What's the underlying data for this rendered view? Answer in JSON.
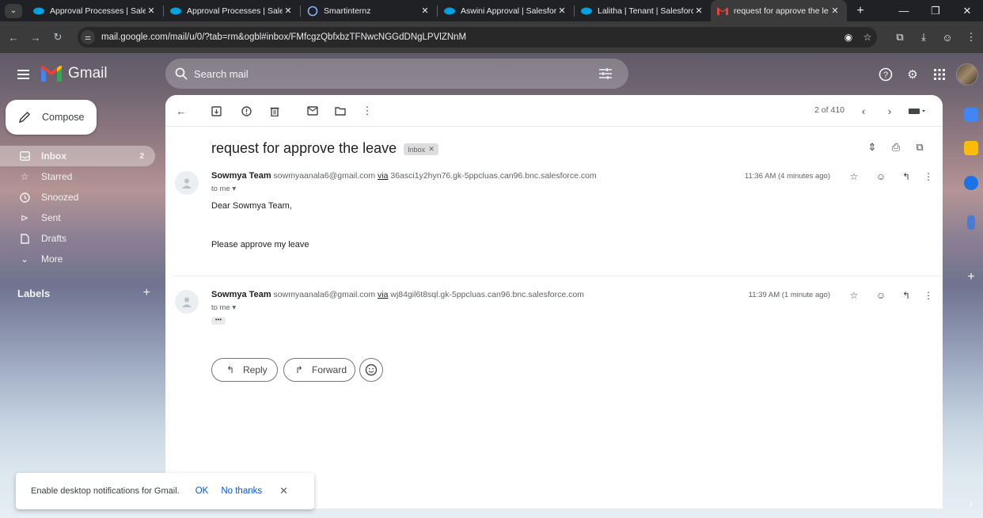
{
  "browser": {
    "tabs": [
      {
        "title": "Approval Processes | Sales",
        "icon": "salesforce-icon",
        "active": false
      },
      {
        "title": "Approval Processes | Sales",
        "icon": "salesforce-icon",
        "active": false
      },
      {
        "title": "Smartinternz",
        "icon": "loading-icon",
        "active": false
      },
      {
        "title": "Aswini Approval | Salesfor",
        "icon": "salesforce-icon",
        "active": false
      },
      {
        "title": "Lalitha | Tenant | Salesforce",
        "icon": "salesforce-icon",
        "active": false
      },
      {
        "title": "request for approve the le",
        "icon": "gmail-icon",
        "active": true
      }
    ],
    "url": "mail.google.com/mail/u/0/?tab=rm&ogbl#inbox/FMfcgzQbfxbzTFNwcNGGdDNgLPVlZNnM"
  },
  "gmail": {
    "brand": "Gmail",
    "search_placeholder": "Search mail",
    "compose_label": "Compose",
    "nav": [
      {
        "label": "Inbox",
        "count": "2",
        "icon": "inbox-icon"
      },
      {
        "label": "Starred",
        "count": "",
        "icon": "star-icon"
      },
      {
        "label": "Snoozed",
        "count": "",
        "icon": "clock-icon"
      },
      {
        "label": "Sent",
        "count": "",
        "icon": "send-icon"
      },
      {
        "label": "Drafts",
        "count": "",
        "icon": "draft-icon"
      },
      {
        "label": "More",
        "count": "",
        "icon": "chevron-down-icon"
      }
    ],
    "labels_header": "Labels",
    "pager": "2 of 410"
  },
  "thread": {
    "subject": "request for approve the leave",
    "label_chip": "Inbox",
    "messages": [
      {
        "sender_name": "Sowmya Team",
        "sender_email": "sowmyaanala6@gmail.com",
        "via_label": "via",
        "via_domain": "36asci1y2hyn76.gk-5ppcluas.can96.bnc.salesforce.com",
        "recipient": "to me",
        "time": "11:36 AM (4 minutes ago)",
        "body": [
          "Dear Sowmya Team,",
          "Please approve my leave"
        ]
      },
      {
        "sender_name": "Sowmya Team",
        "sender_email": "sowmyaanala6@gmail.com",
        "via_label": "via",
        "via_domain": "wj84gil6t8sql.gk-5ppcluas.can96.bnc.salesforce.com",
        "recipient": "to me",
        "time": "11:39 AM (1 minute ago)",
        "collapsed_marker": "•••"
      }
    ],
    "actions": {
      "reply": "Reply",
      "forward": "Forward"
    }
  },
  "notification": {
    "message": "Enable desktop notifications for Gmail.",
    "ok": "OK",
    "dismiss": "No thanks"
  },
  "colors": {
    "gmail_red": "#ea4335",
    "link_blue": "#0b57d0",
    "salesforce_blue": "#00a1e0"
  }
}
